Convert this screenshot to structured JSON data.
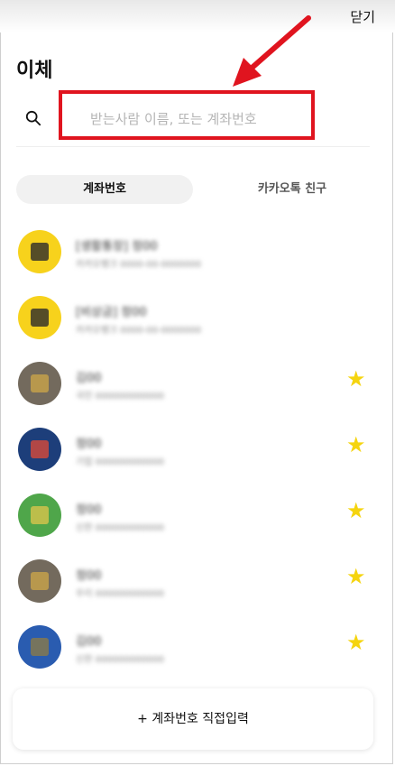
{
  "header": {
    "close_label": "닫기",
    "title": "이체"
  },
  "search": {
    "placeholder": "받는사람 이름, 또는 계좌번호"
  },
  "tabs": [
    {
      "label": "계좌번호",
      "active": true
    },
    {
      "label": "카카오톡 친구",
      "active": false
    }
  ],
  "recipients": [
    {
      "name": "[생활통장] 정00",
      "sub": "카카오뱅크 0000-00-0000000",
      "avatar_color": "#f7d21c",
      "glyph_color": "#2c2c2c",
      "favorite": false
    },
    {
      "name": "[비상금] 정00",
      "sub": "카카오뱅크 0000-00-0000000",
      "avatar_color": "#f7d21c",
      "glyph_color": "#2c2c2c",
      "favorite": false
    },
    {
      "name": "김00",
      "sub": "국민 000000000000",
      "avatar_color": "#736a5d",
      "glyph_color": "#c9a44a",
      "favorite": true
    },
    {
      "name": "정00",
      "sub": "기업 000000000000",
      "avatar_color": "#1d3e7a",
      "glyph_color": "#d84a3a",
      "favorite": true
    },
    {
      "name": "정00",
      "sub": "신한 000000000000",
      "avatar_color": "#4fa64a",
      "glyph_color": "#d7c44b",
      "favorite": true
    },
    {
      "name": "정00",
      "sub": "우리 000000000000",
      "avatar_color": "#736a5d",
      "glyph_color": "#c9a44a",
      "favorite": true
    },
    {
      "name": "김00",
      "sub": "신한 000000000000",
      "avatar_color": "#2a5cb0",
      "glyph_color": "#8a7a4a",
      "favorite": true
    }
  ],
  "direct_input": {
    "label": "+ 계좌번호 직접입력"
  },
  "colors": {
    "highlight": "#e0141f",
    "star": "#f5d40f"
  },
  "icons": {
    "search": "search-icon",
    "favorite": "star-icon",
    "annotation": "red-arrow"
  }
}
